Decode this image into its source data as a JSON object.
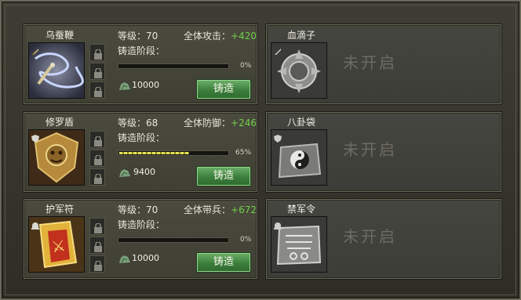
{
  "labels": {
    "level_prefix": "等级：",
    "forge_stage": "铸造阶段：",
    "forge_button": "铸造",
    "not_opened": "未开启"
  },
  "left_items": [
    {
      "name": "乌蚕鞭",
      "level": "70",
      "attr_label": "全体攻击：",
      "attr_value": "+420",
      "progress": 0,
      "progress_text": "0%",
      "cost": "10000",
      "type_icon": "sword-icon"
    },
    {
      "name": "修罗盾",
      "level": "68",
      "attr_label": "全体防御：",
      "attr_value": "+246",
      "progress": 65,
      "progress_text": "65%",
      "cost": "9400",
      "type_icon": "shield-icon"
    },
    {
      "name": "护军符",
      "level": "70",
      "attr_label": "全体带兵：",
      "attr_value": "+672",
      "progress": 0,
      "progress_text": "0%",
      "cost": "10000",
      "type_icon": "helmet-icon"
    }
  ],
  "right_items": [
    {
      "name": "血滴子",
      "type_icon": "sword-icon"
    },
    {
      "name": "八卦袋",
      "type_icon": "shield-icon"
    },
    {
      "name": "禁军令",
      "type_icon": "helmet-icon"
    }
  ],
  "colors": {
    "accent_green": "#6fd04a",
    "button_green": "#3c7e3c",
    "progress_yellow": "#e7e35a"
  }
}
